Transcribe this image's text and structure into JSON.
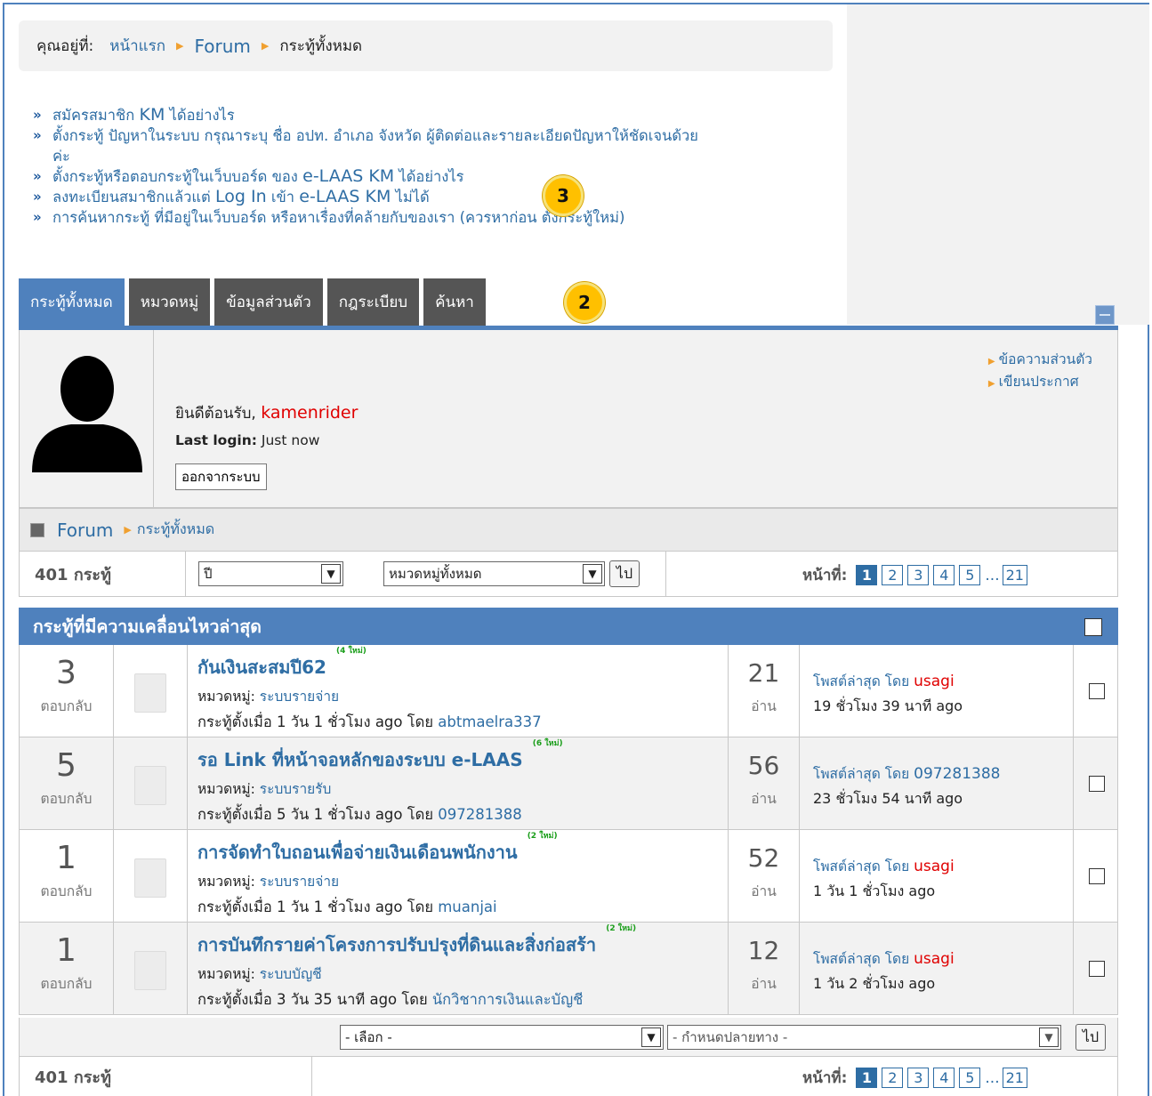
{
  "breadcrumb": {
    "prefix": "คุณอยู่ที่:",
    "home": "หน้าแรก",
    "forum": "Forum",
    "current": "กระทู้ทั้งหมด"
  },
  "help_links": [
    {
      "parts": [
        "สมัครสมาชิก ",
        "KM",
        " ได้อย่างไร"
      ]
    },
    {
      "parts": [
        "ตั้งกระทู้ ปัญหาในระบบ กรุณาระบุ ชื่อ อปท. อำเภอ จังหวัด ผู้ติดต่อและรายละเอียดปัญหาให้ชัดเจนด้วย",
        "",
        ""
      ],
      "wrap": "ค่ะ"
    },
    {
      "parts": [
        "ตั้งกระทู้หรือตอบกระทู้ในเว็บบอร์ด ของ ",
        "e-LAAS KM",
        " ได้อย่างไร"
      ]
    },
    {
      "parts": [
        "ลงทะเบียนสมาชิกแล้วแต่ ",
        "Log In",
        " เข้า "
      ],
      "tail_en": "e-LAAS KM",
      "tail": " ไม่ได้"
    },
    {
      "parts": [
        "การค้นหากระทู้ ที่มีอยู่ในเว็บบอร์ด หรือหาเรื่องที่คล้ายกับของเรา (ควรหาก่อน ตั้งกระทู้ใหม่)",
        "",
        ""
      ]
    }
  ],
  "badges": {
    "tabs": "2",
    "links": "3"
  },
  "tabs": [
    "กระทู้ทั้งหมด",
    "หมวดหมู่",
    "ข้อมูลส่วนตัว",
    "กฎระเบียบ",
    "ค้นหา"
  ],
  "profile": {
    "welcome": "ยินดีต้อนรับ, ",
    "username": "kamenrider",
    "last_login_label": "Last login:",
    "last_login_value": " Just now",
    "logout": "ออกจากระบบ",
    "links": [
      "ข้อความส่วนตัว",
      "เขียนประกาศ"
    ]
  },
  "forum_crumb": {
    "forum": "Forum",
    "current": "กระทู้ทั้งหมด"
  },
  "filter": {
    "count": "401 กระทู้",
    "year": "ปี",
    "category": "หมวดหมู่ทั้งหมด",
    "go": "ไป",
    "page_label": "หน้าที่:",
    "pages": [
      "1",
      "2",
      "3",
      "4",
      "5"
    ],
    "dots": "...",
    "last_page": "21"
  },
  "list_header": "กระทู้ที่มีความเคลื่อนไหวล่าสุด",
  "topics": [
    {
      "replies": "3",
      "replies_label": "ตอบกลับ",
      "title": "กันเงินสะสมปี62",
      "new_tag": "(4 ใหม่)",
      "cat_label": "หมวดหมู่: ",
      "cat": "ระบบรายจ่าย",
      "started": "กระทู้ตั้งเมื่อ 1 วัน 1 ชั่วโมง ago โดย ",
      "author": "abtmaelra337",
      "views": "21",
      "views_label": "อ่าน",
      "lp_label": "โพสต์ล่าสุด โดย ",
      "lp_user": "usagi",
      "lp_user_color": "red",
      "lp_time": "19 ชั่วโมง 39 นาที ago"
    },
    {
      "replies": "5",
      "replies_label": "ตอบกลับ",
      "title": "รอ Link ที่หน้าจอหลักของระบบ e-LAAS",
      "new_tag": "(6 ใหม่)",
      "cat_label": "หมวดหมู่: ",
      "cat": "ระบบรายรับ",
      "started": "กระทู้ตั้งเมื่อ 5 วัน 1 ชั่วโมง ago โดย ",
      "author": "097281388",
      "views": "56",
      "views_label": "อ่าน",
      "lp_label": "โพสต์ล่าสุด โดย ",
      "lp_user": "097281388",
      "lp_user_color": "blue",
      "lp_time": "23 ชั่วโมง 54 นาที ago"
    },
    {
      "replies": "1",
      "replies_label": "ตอบกลับ",
      "title": "การจัดทำใบถอนเพื่อจ่ายเงินเดือนพนักงาน",
      "new_tag": "(2 ใหม่)",
      "cat_label": "หมวดหมู่: ",
      "cat": "ระบบรายจ่าย",
      "started": "กระทู้ตั้งเมื่อ 1 วัน 1 ชั่วโมง ago โดย ",
      "author": "muanjai",
      "views": "52",
      "views_label": "อ่าน",
      "lp_label": "โพสต์ล่าสุด โดย ",
      "lp_user": "usagi",
      "lp_user_color": "red",
      "lp_time": "1 วัน 1 ชั่วโมง ago"
    },
    {
      "replies": "1",
      "replies_label": "ตอบกลับ",
      "title": "การบันทึกรายค่าโครงการปรับปรุงที่ดินและสิ่งก่อสร้า",
      "new_tag": "(2 ใหม่)",
      "cat_label": "หมวดหมู่: ",
      "cat": "ระบบบัญชี",
      "started": "กระทู้ตั้งเมื่อ 3 วัน 35 นาที ago โดย ",
      "author": "นักวิชาการเงินและบัญชี",
      "views": "12",
      "views_label": "อ่าน",
      "lp_label": "โพสต์ล่าสุด โดย ",
      "lp_user": "usagi",
      "lp_user_color": "red",
      "lp_time": "1 วัน 2 ชั่วโมง ago"
    }
  ],
  "actions": {
    "select": "- เลือก -",
    "destination": "- กำหนดปลายทาง -",
    "go": "ไป"
  },
  "footer": {
    "count": "401 กระทู้"
  }
}
